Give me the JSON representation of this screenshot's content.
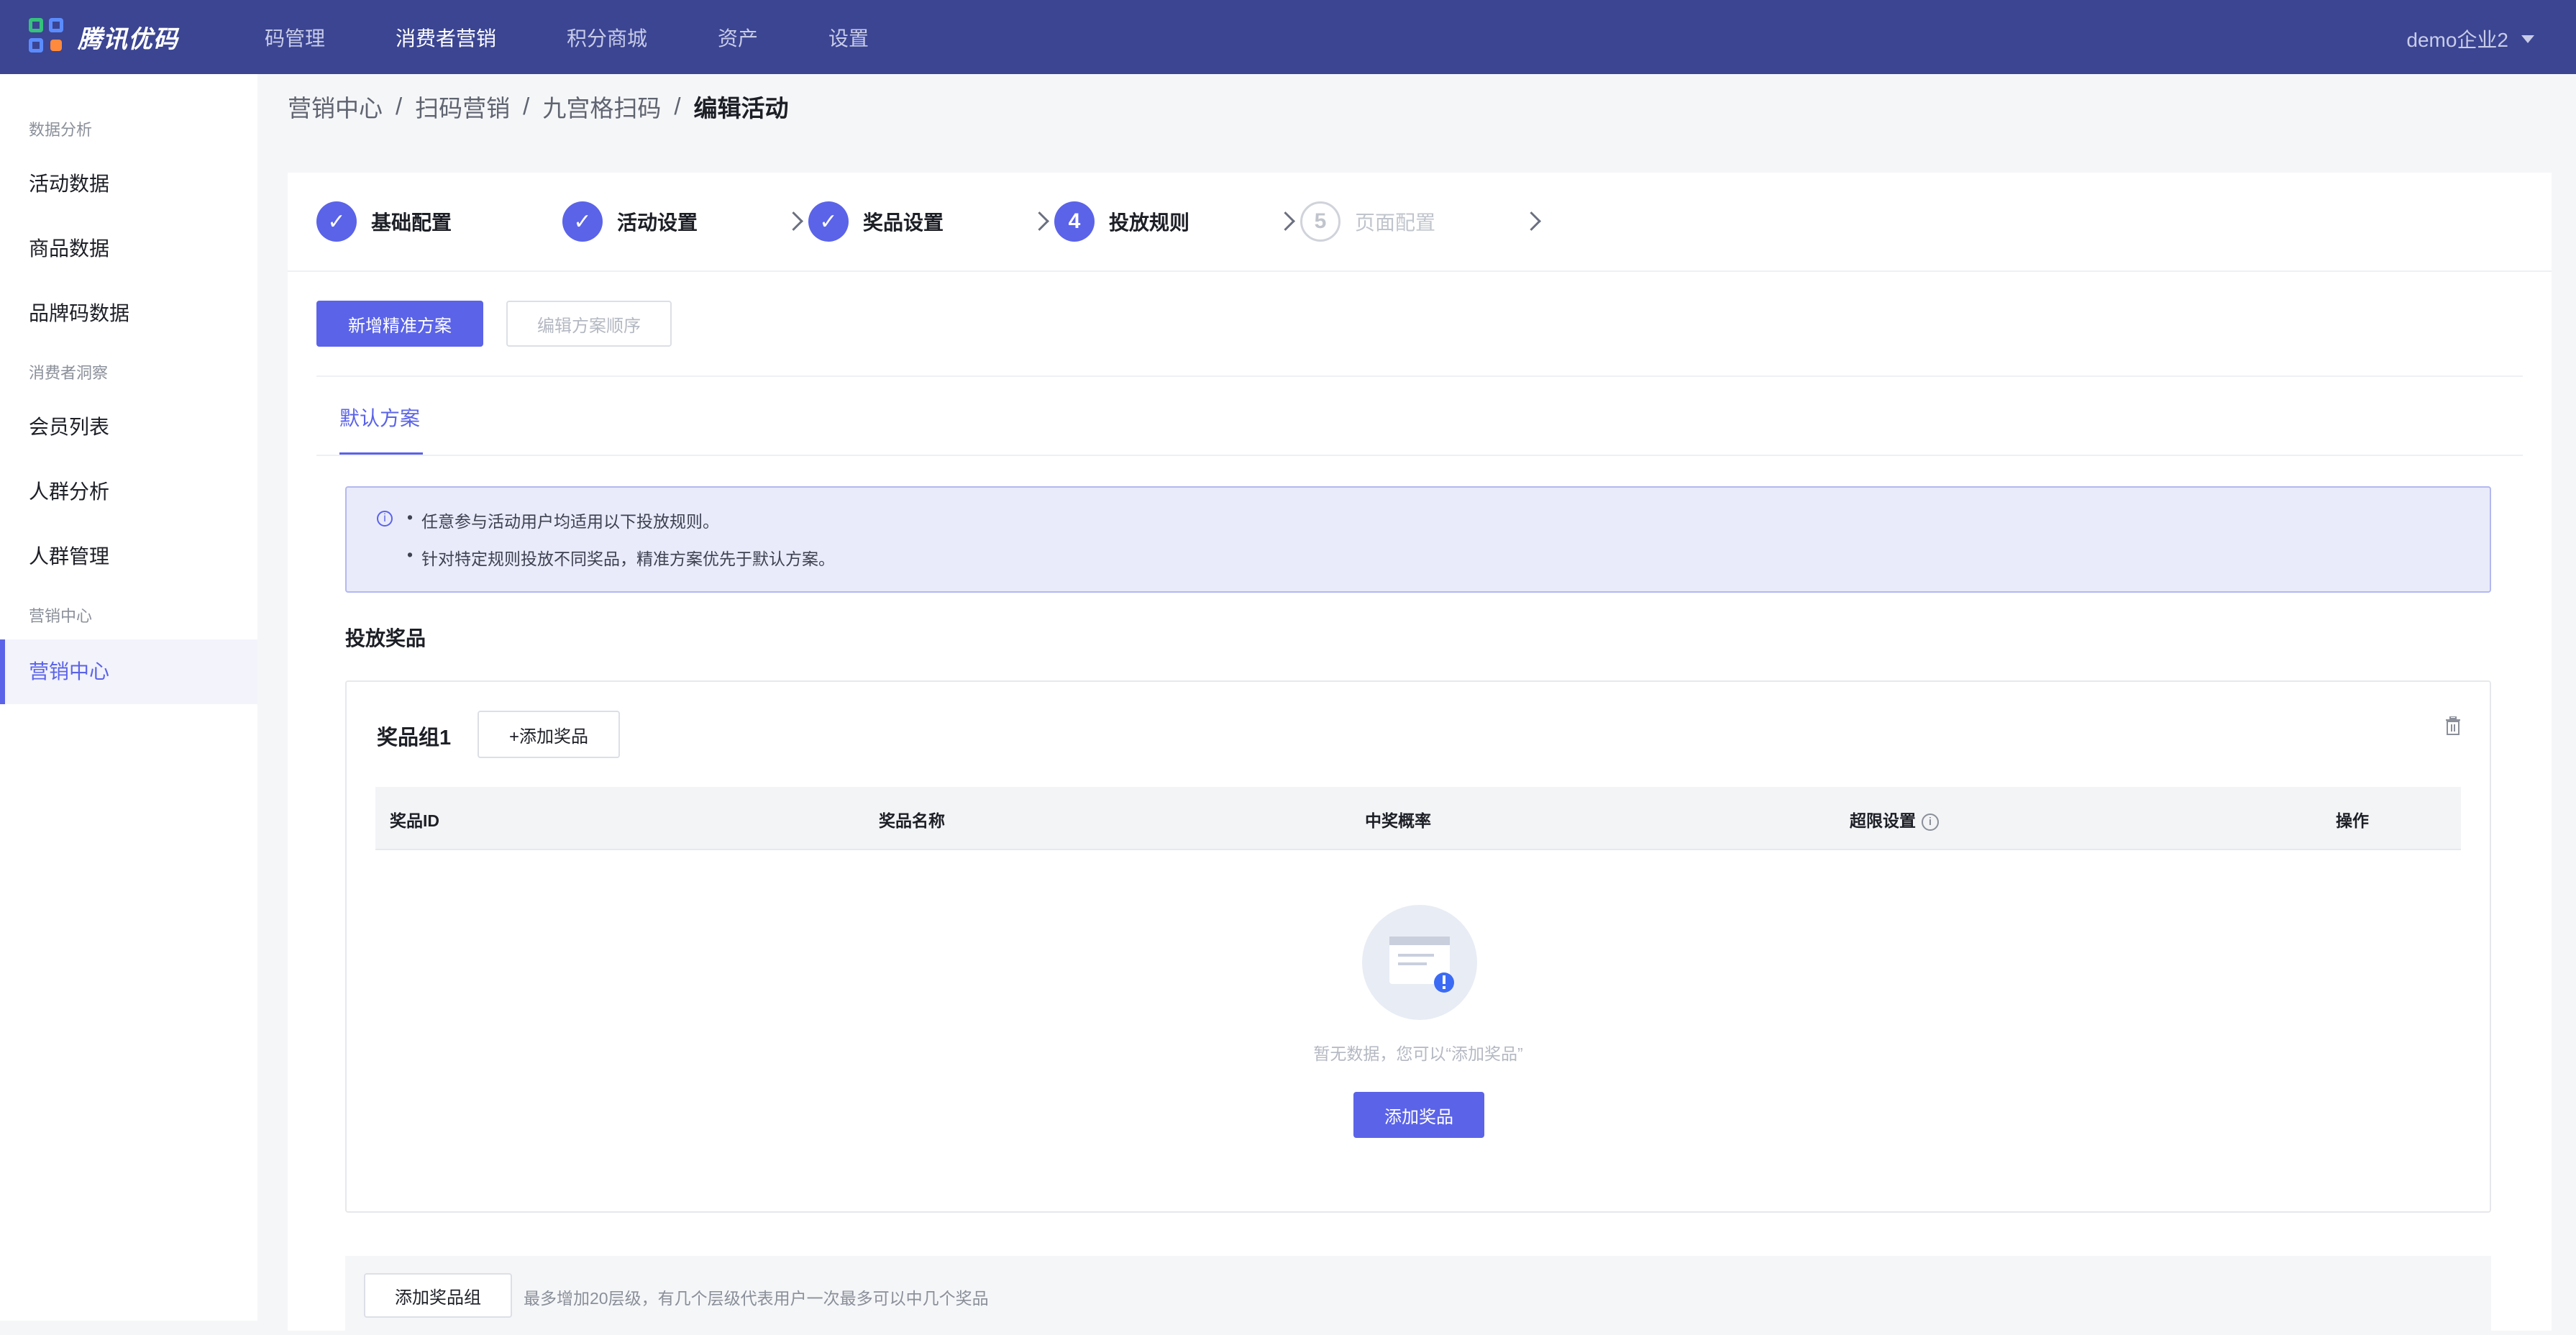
{
  "brand": {
    "name": "腾讯优码"
  },
  "topnav": {
    "items": [
      "码管理",
      "消费者营销",
      "积分商城",
      "资产",
      "设置"
    ],
    "active_index": 1,
    "user": "demo企业2"
  },
  "sidebar": {
    "groups": [
      {
        "label": "数据分析",
        "items": [
          "活动数据",
          "商品数据",
          "品牌码数据"
        ]
      },
      {
        "label": "消费者洞察",
        "items": [
          "会员列表",
          "人群分析",
          "人群管理"
        ]
      },
      {
        "label": "营销中心",
        "items": [
          "营销中心"
        ]
      }
    ],
    "active_item": "营销中心"
  },
  "breadcrumb": {
    "items": [
      "营销中心",
      "扫码营销",
      "九宫格扫码"
    ],
    "current": "编辑活动",
    "separator": "/"
  },
  "steps": [
    {
      "label": "基础配置",
      "state": "done"
    },
    {
      "label": "活动设置",
      "state": "done"
    },
    {
      "label": "奖品设置",
      "state": "done"
    },
    {
      "label": "投放规则",
      "state": "current",
      "number": "4"
    },
    {
      "label": "页面配置",
      "state": "pending",
      "number": "5"
    }
  ],
  "toolbar": {
    "add_plan": "新增精准方案",
    "edit_order": "编辑方案顺序"
  },
  "tabs": {
    "default": "默认方案"
  },
  "alert": {
    "lines": [
      "任意参与活动用户均适用以下投放规则。",
      "针对特定规则投放不同奖品，精准方案优先于默认方案。"
    ]
  },
  "section": {
    "title": "投放奖品"
  },
  "prize_group": {
    "title": "奖品组1",
    "add_button": "+添加奖品",
    "columns": [
      "奖品ID",
      "奖品名称",
      "中奖概率",
      "超限设置",
      "操作"
    ],
    "empty_text": "暂无数据，您可以“添加奖品”",
    "empty_button": "添加奖品"
  },
  "footer": {
    "add_group": "添加奖品组",
    "hint": "最多增加20层级，有几个层级代表用户一次最多可以中几个奖品"
  },
  "colors": {
    "nav_bg": "#3b4592",
    "primary": "#5b63e8",
    "alert_bg": "#e9ebfb"
  }
}
